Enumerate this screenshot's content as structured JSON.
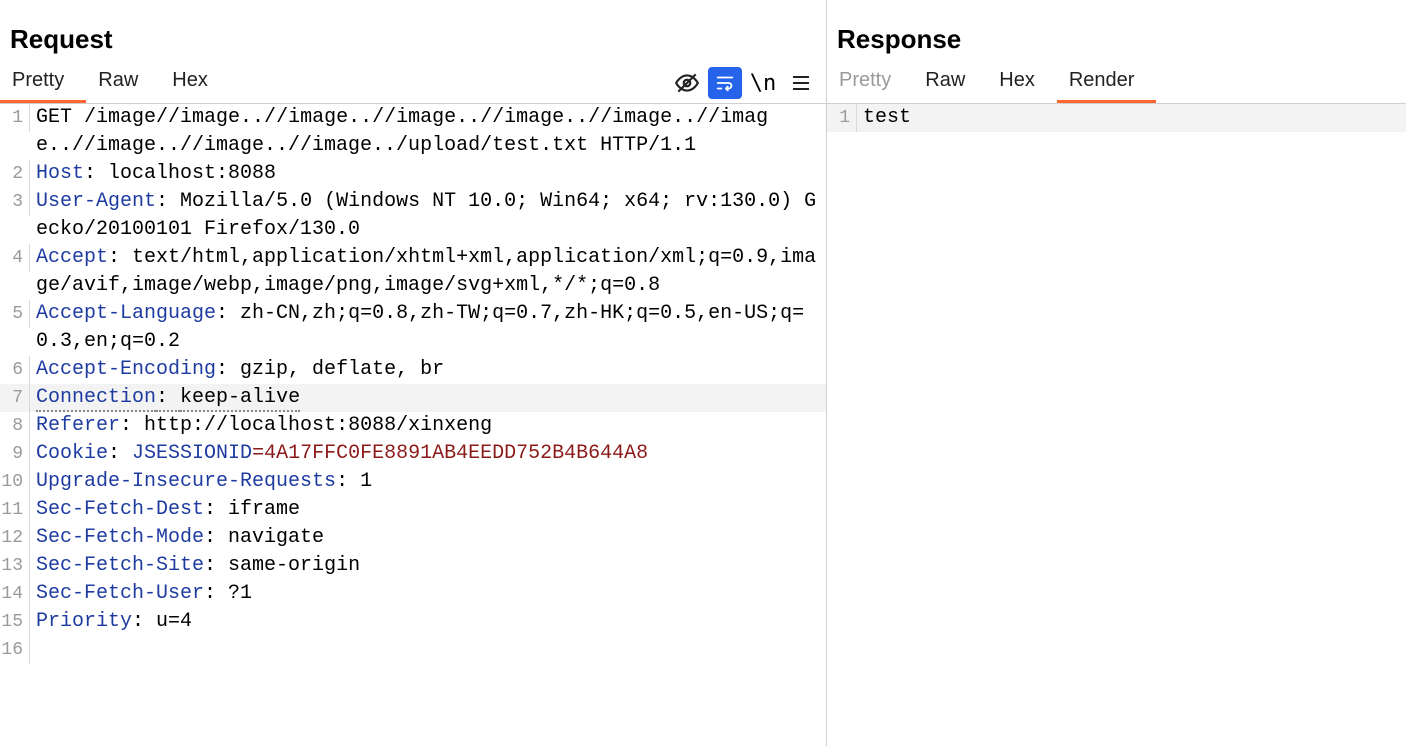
{
  "request": {
    "title": "Request",
    "tabs": [
      "Pretty",
      "Raw",
      "Hex"
    ],
    "active_tab": "Pretty",
    "toolbar_icons": [
      "visibility-off-icon",
      "wrap-icon",
      "newline-icon",
      "menu-icon"
    ],
    "highlighted_line": 7,
    "lines": [
      {
        "n": 1,
        "type": "startline",
        "method": "GET",
        "path": "/image//image..//image..//image..//image..//image..//image..//image..//image..//image../upload/test.txt",
        "protocol": "HTTP/1.1"
      },
      {
        "n": 2,
        "type": "header",
        "key": "Host",
        "value": "localhost:8088"
      },
      {
        "n": 3,
        "type": "header",
        "key": "User-Agent",
        "value": "Mozilla/5.0 (Windows NT 10.0; Win64; x64; rv:130.0) Gecko/20100101 Firefox/130.0"
      },
      {
        "n": 4,
        "type": "header",
        "key": "Accept",
        "value": "text/html,application/xhtml+xml,application/xml;q=0.9,image/avif,image/webp,image/png,image/svg+xml,*/*;q=0.8"
      },
      {
        "n": 5,
        "type": "header",
        "key": "Accept-Language",
        "value": "zh-CN,zh;q=0.8,zh-TW;q=0.7,zh-HK;q=0.5,en-US;q=0.3,en;q=0.2"
      },
      {
        "n": 6,
        "type": "header",
        "key": "Accept-Encoding",
        "value": "gzip, deflate, br"
      },
      {
        "n": 7,
        "type": "header",
        "key": "Connection",
        "value": "keep-alive"
      },
      {
        "n": 8,
        "type": "header",
        "key": "Referer",
        "value": "http://localhost:8088/xinxeng"
      },
      {
        "n": 9,
        "type": "cookie",
        "key": "Cookie",
        "cookie_name": "JSESSIONID",
        "cookie_value": "4A17FFC0FE8891AB4EEDD752B4B644A8"
      },
      {
        "n": 10,
        "type": "header",
        "key": "Upgrade-Insecure-Requests",
        "value": "1"
      },
      {
        "n": 11,
        "type": "header",
        "key": "Sec-Fetch-Dest",
        "value": "iframe"
      },
      {
        "n": 12,
        "type": "header",
        "key": "Sec-Fetch-Mode",
        "value": "navigate"
      },
      {
        "n": 13,
        "type": "header",
        "key": "Sec-Fetch-Site",
        "value": "same-origin"
      },
      {
        "n": 14,
        "type": "header",
        "key": "Sec-Fetch-User",
        "value": "?1"
      },
      {
        "n": 15,
        "type": "header",
        "key": "Priority",
        "value": "u=4"
      },
      {
        "n": 16,
        "type": "blank"
      }
    ]
  },
  "response": {
    "title": "Response",
    "tabs": [
      "Pretty",
      "Raw",
      "Hex",
      "Render"
    ],
    "active_tab": "Render",
    "disabled_tabs": [
      "Pretty"
    ],
    "lines": [
      {
        "n": 1,
        "text": "test"
      }
    ]
  }
}
